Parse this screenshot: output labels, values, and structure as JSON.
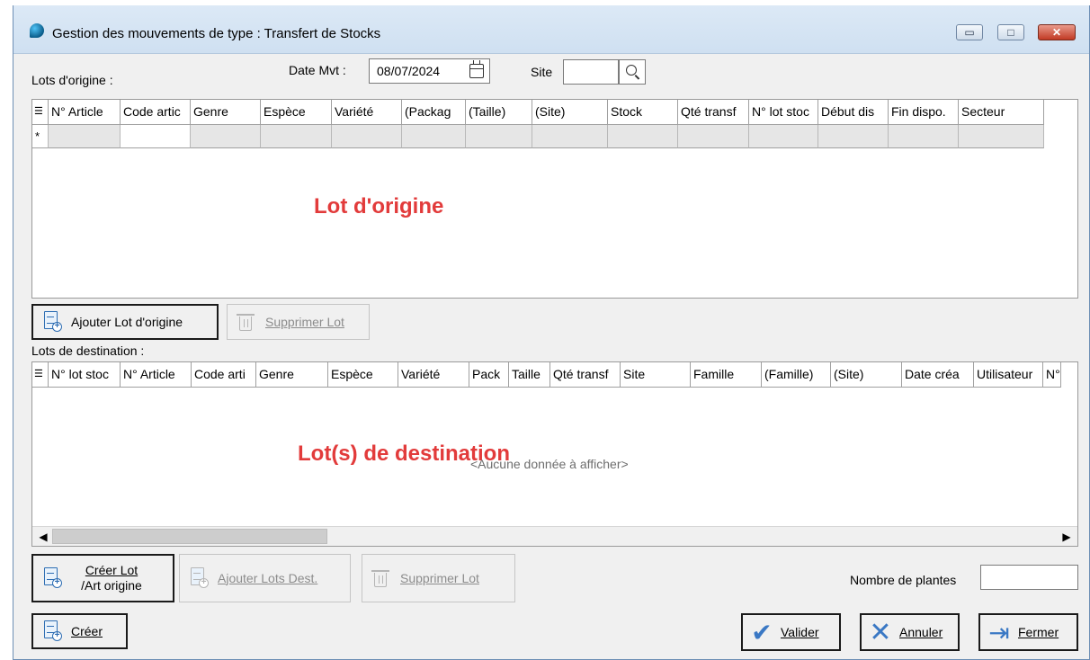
{
  "window": {
    "title": "Gestion des mouvements de type : Transfert de Stocks",
    "controls": {
      "minimize": "▭",
      "maximize": "□",
      "close": "✕"
    }
  },
  "header": {
    "lots_origine_label": "Lots d'origine :",
    "date_label": "Date Mvt :",
    "date_value": "08/07/2024",
    "site_label": "Site",
    "site_value": ""
  },
  "origin_grid": {
    "columns": [
      "N° Article",
      "Code artic",
      "Genre",
      "Espèce",
      "Variété",
      "(Packag",
      "(Taille)",
      "(Site)",
      "Stock",
      "Qté transf",
      "N° lot stoc",
      "Début dis",
      "Fin dispo.",
      "Secteur"
    ],
    "new_row_marker": "*",
    "overlay_label": "Lot d'origine"
  },
  "origin_buttons": {
    "add_label": "Ajouter Lot d'origine",
    "delete_label": "Supprimer Lot"
  },
  "dest_section": {
    "label": "Lots de destination :"
  },
  "dest_grid": {
    "columns": [
      "N° lot stoc",
      "N° Article",
      "Code arti",
      "Genre",
      "Espèce",
      "Variété",
      "Pack",
      "Taille",
      "Qté transf",
      "Site",
      "Famille",
      "(Famille)",
      "(Site)",
      "Date créa",
      "Utilisateur",
      "N°"
    ],
    "overlay_label": "Lot(s) de destination",
    "empty_text": "<Aucune donnée à afficher>"
  },
  "dest_buttons": {
    "create_line1": "Créer Lot",
    "create_line2": "/Art origine",
    "add_label": "Ajouter Lots Dest.",
    "delete_label": "Supprimer Lot"
  },
  "plants": {
    "label": "Nombre de plantes",
    "value": ""
  },
  "footer": {
    "create_label": "Créer",
    "validate_label": "Valider",
    "cancel_label": "Annuler",
    "close_label": "Fermer"
  },
  "icons": {
    "add": "doc-plus-icon",
    "delete": "trash-icon",
    "validate": "check-icon",
    "cancel": "x-icon",
    "close": "exit-door-icon"
  }
}
